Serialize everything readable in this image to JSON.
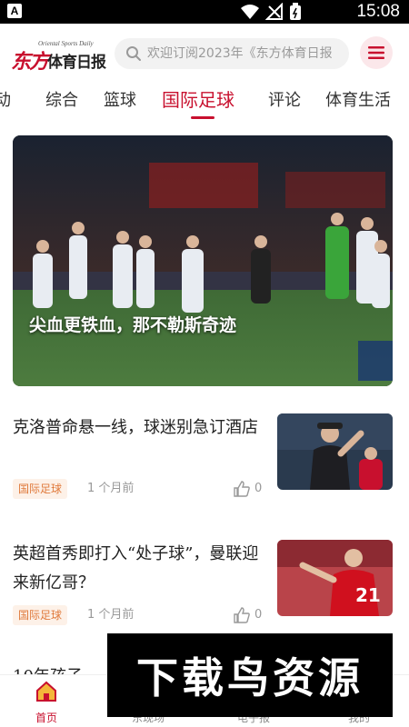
{
  "status_bar": {
    "notification_glyph": "A",
    "time": "15:08"
  },
  "header": {
    "logo_brand_en": "Oriental Sports Daily",
    "logo_mark": "东方",
    "logo_text": "体育日报",
    "search_placeholder": "欢迎订阅2023年《东方体育日报",
    "accent_color": "#c8102e"
  },
  "tabs": [
    {
      "label": "动"
    },
    {
      "label": "综合"
    },
    {
      "label": "篮球"
    },
    {
      "label": "国际足球",
      "active": true
    },
    {
      "label": "评论"
    },
    {
      "label": "体育生活"
    }
  ],
  "hero": {
    "title": "尖血更铁血，那不勒斯奇迹"
  },
  "articles": [
    {
      "title": "克洛普命悬一线，球迷别急订酒店",
      "tag": "国际足球",
      "time": "1 个月前",
      "likes": "0"
    },
    {
      "title": "英超首秀即打入“处子球”，曼联迎来新亿哥？",
      "tag": "国际足球",
      "time": "1 个月前",
      "likes": "0"
    }
  ],
  "partial_article_title": "10年孩子",
  "watermark": "下载鸟资源",
  "bottom_nav": [
    {
      "label": "首页",
      "icon": "home-icon",
      "active": true
    },
    {
      "label": "东现场",
      "icon": "live-icon"
    },
    {
      "label": "电子报",
      "icon": "epaper-icon"
    },
    {
      "label": "我的",
      "icon": "profile-icon"
    }
  ]
}
